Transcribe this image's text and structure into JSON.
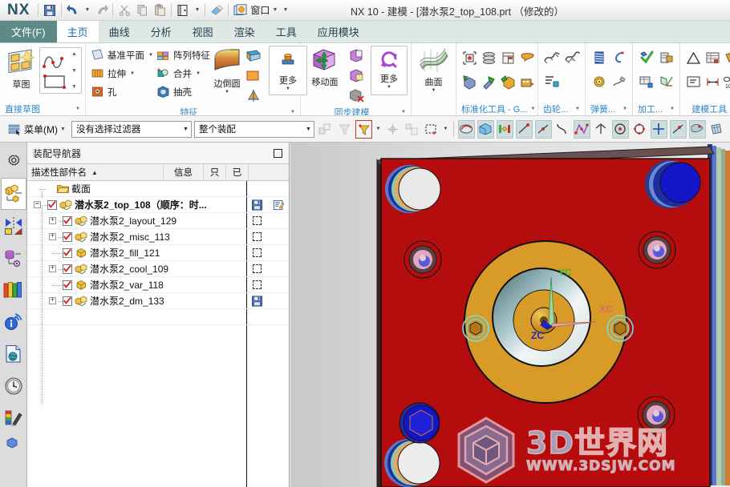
{
  "window": {
    "title": "NX 10 - 建模 - [潜水泵2_top_108.prt （修改的）",
    "logo": "NX",
    "window_menu_label": "窗口"
  },
  "quick_access": [
    {
      "name": "save-icon",
      "label": "保存"
    },
    {
      "name": "undo-icon",
      "label": "撤销"
    },
    {
      "name": "redo-icon",
      "label": "重做"
    },
    {
      "name": "cut-icon",
      "label": "剪切"
    },
    {
      "name": "copy-icon",
      "label": "复制"
    },
    {
      "name": "paste-icon",
      "label": "粘贴"
    },
    {
      "name": "open-part-icon",
      "label": "打开"
    },
    {
      "name": "eraser-icon",
      "label": "擦除"
    },
    {
      "name": "window-switch-icon",
      "label": "窗口"
    }
  ],
  "tabs": [
    {
      "label": "文件(F)",
      "active": false,
      "kind": "file"
    },
    {
      "label": "主页",
      "active": true
    },
    {
      "label": "曲线",
      "active": false
    },
    {
      "label": "分析",
      "active": false
    },
    {
      "label": "视图",
      "active": false
    },
    {
      "label": "渲染",
      "active": false
    },
    {
      "label": "工具",
      "active": false
    },
    {
      "label": "应用模块",
      "active": false
    }
  ],
  "ribbon": {
    "groups": [
      {
        "label": "直接草图",
        "big": {
          "label": "草图",
          "icon": "sketch-icon"
        },
        "items": []
      },
      {
        "label": "特征",
        "items": [
          {
            "label": "基准平面",
            "icon": "datum-plane-icon",
            "caret": true
          },
          {
            "label": "拉伸",
            "icon": "extrude-icon",
            "caret": true
          },
          {
            "label": "孔",
            "icon": "hole-icon",
            "caret": false
          },
          {
            "label": "阵列特征",
            "icon": "pattern-feature-icon",
            "caret": false
          },
          {
            "label": "合并",
            "icon": "unite-icon",
            "caret": true
          },
          {
            "label": "抽壳",
            "icon": "shell-icon",
            "caret": false
          }
        ],
        "big_items": [
          {
            "label": "边倒圆",
            "icon": "edge-blend-icon"
          },
          {
            "label": "更多",
            "icon": "more-feature-icon"
          }
        ]
      },
      {
        "label": "同步建模",
        "big_items": [
          {
            "label": "移动面",
            "icon": "move-face-icon"
          },
          {
            "label": "更多",
            "icon": "more-sync-icon"
          }
        ]
      },
      {
        "label": "",
        "big_items": [
          {
            "label": "曲面",
            "icon": "surface-icon"
          }
        ]
      },
      {
        "label": "标准化工具 - G...",
        "items": []
      },
      {
        "label": "齿轮...",
        "items": []
      },
      {
        "label": "弹簧...",
        "items": []
      },
      {
        "label": "加工...",
        "items": []
      },
      {
        "label": "建模工具 - G...",
        "items": []
      }
    ]
  },
  "selection_toolbar": {
    "menu_label": "菜单(M)",
    "filter_value": "没有选择过滤器",
    "scope_value": "整个装配",
    "snap_icons": [
      "snap-point-icon",
      "snap-endpoint-icon",
      "snap-midpoint-icon",
      "snap-control-point-icon",
      "snap-intersection-icon",
      "snap-arc-center-icon",
      "snap-quadrant-icon",
      "snap-existing-point-icon",
      "snap-point-on-curve-icon",
      "snap-point-on-face-icon",
      "snap-face-icon"
    ]
  },
  "rail": {
    "items": [
      {
        "name": "rail-item-settings",
        "icon": "gear-icon",
        "active": false
      },
      {
        "name": "rail-item-assembly-navigator",
        "icon": "assembly-navigator-icon",
        "active": true
      },
      {
        "name": "rail-item-constraint-navigator",
        "icon": "constraint-navigator-icon",
        "active": false
      },
      {
        "name": "rail-item-part-navigator",
        "icon": "part-navigator-icon",
        "active": false
      },
      {
        "name": "rail-item-reuse-library",
        "icon": "reuse-library-icon",
        "active": false
      },
      {
        "name": "rail-item-hd3d-tools",
        "icon": "info-broadcast-icon",
        "active": false
      },
      {
        "name": "rail-item-web-browser",
        "icon": "web-page-icon",
        "active": false
      },
      {
        "name": "rail-item-history",
        "icon": "clock-icon",
        "active": false
      },
      {
        "name": "rail-item-roles",
        "icon": "palette-brush-icon",
        "active": false
      }
    ]
  },
  "navigator": {
    "title": "装配导航器",
    "columns": [
      {
        "label": "描述性部件名",
        "sorted": true
      },
      {
        "label": "信息"
      },
      {
        "label": "只"
      },
      {
        "label": "已"
      }
    ],
    "rows": [
      {
        "label": "截面",
        "indent": 1,
        "icon": "folder-icon",
        "expander": "",
        "checkbox": false,
        "bold": false,
        "mark": ""
      },
      {
        "label": "潜水泵2_top_108（顺序：时...",
        "indent": 0,
        "icon": "assembly-icon",
        "expander": "-",
        "checkbox": true,
        "bold": true,
        "mark": "save",
        "extra": "edit"
      },
      {
        "label": "潜水泵2_layout_129",
        "indent": 1,
        "icon": "assembly-icon",
        "expander": "+",
        "checkbox": true,
        "bold": false,
        "mark": "dash"
      },
      {
        "label": "潜水泵2_misc_113",
        "indent": 1,
        "icon": "assembly-icon",
        "expander": "+",
        "checkbox": true,
        "bold": false,
        "mark": "dash"
      },
      {
        "label": "潜水泵2_fill_121",
        "indent": 1,
        "icon": "part-icon",
        "expander": "",
        "checkbox": true,
        "bold": false,
        "mark": "dash"
      },
      {
        "label": "潜水泵2_cool_109",
        "indent": 1,
        "icon": "assembly-icon",
        "expander": "+",
        "checkbox": true,
        "bold": false,
        "mark": "dash"
      },
      {
        "label": "潜水泵2_var_118",
        "indent": 1,
        "icon": "part-icon",
        "expander": "",
        "checkbox": true,
        "bold": false,
        "mark": "dash"
      },
      {
        "label": "潜水泵2_dm_133",
        "indent": 1,
        "icon": "assembly-icon",
        "expander": "+",
        "checkbox": true,
        "bold": false,
        "mark": "save"
      }
    ]
  },
  "viewport": {
    "axes": {
      "x_label": "XC",
      "y_label": "YC",
      "z_label": "ZC"
    },
    "colors": {
      "plate": "#b50d0d",
      "bore": "#d89b28",
      "accent_blue": "#1515c8",
      "x_axis": "#d96a6a",
      "y_axis": "#39b54a",
      "z_axis": "#2222cc"
    },
    "watermark": {
      "main": "3D世界网",
      "sub": "WWW.3DSJW.COM"
    }
  }
}
